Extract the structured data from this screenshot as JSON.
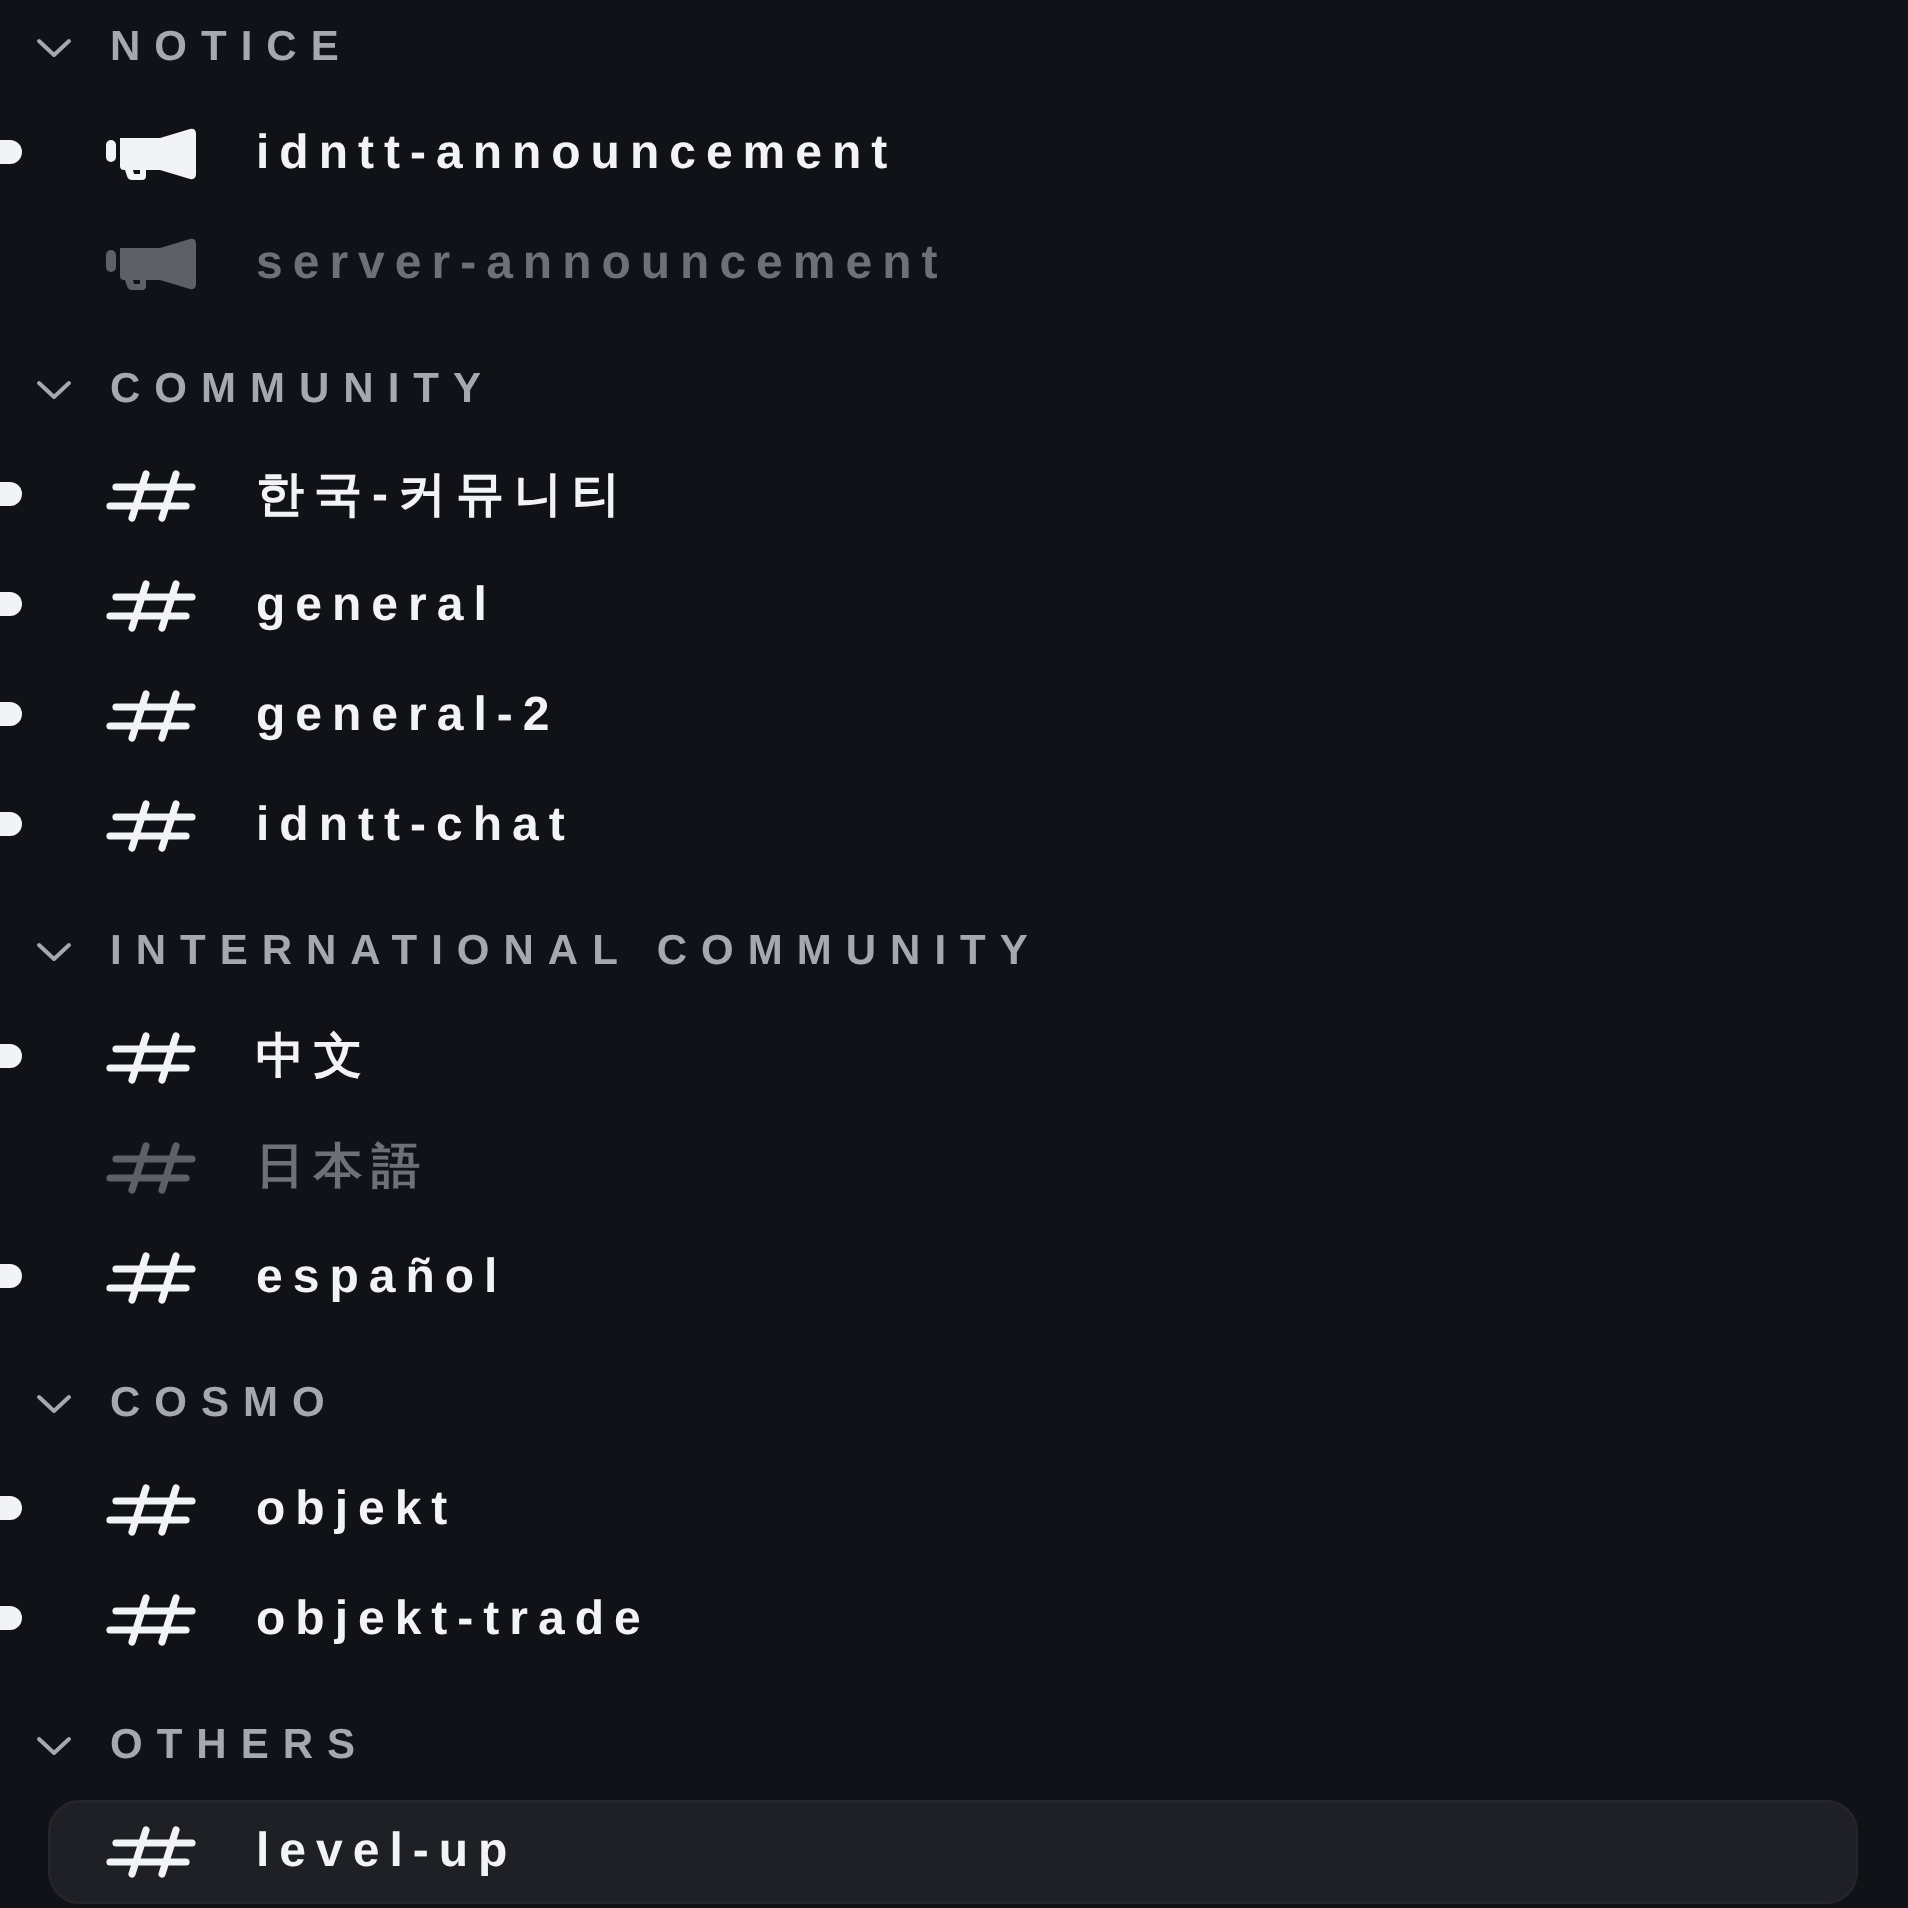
{
  "categories": [
    {
      "name": "NOTICE",
      "expanded": true,
      "channels": [
        {
          "kind": "announcement",
          "name": "idntt-announcement",
          "unread": true,
          "selected": false
        },
        {
          "kind": "announcement",
          "name": "server-announcement",
          "unread": false,
          "selected": false
        }
      ]
    },
    {
      "name": "COMMUNITY",
      "expanded": true,
      "channels": [
        {
          "kind": "text",
          "name": "한국-커뮤니티",
          "unread": true,
          "selected": false
        },
        {
          "kind": "text",
          "name": "general",
          "unread": true,
          "selected": false
        },
        {
          "kind": "text",
          "name": "general-2",
          "unread": true,
          "selected": false
        },
        {
          "kind": "text",
          "name": "idntt-chat",
          "unread": true,
          "selected": false
        }
      ]
    },
    {
      "name": "INTERNATIONAL COMMUNITY",
      "expanded": true,
      "channels": [
        {
          "kind": "text",
          "name": "中文",
          "unread": true,
          "selected": false
        },
        {
          "kind": "text",
          "name": "日本語",
          "unread": false,
          "selected": false
        },
        {
          "kind": "text",
          "name": "español",
          "unread": true,
          "selected": false
        }
      ]
    },
    {
      "name": "COSMO",
      "expanded": true,
      "channels": [
        {
          "kind": "text",
          "name": "objekt",
          "unread": true,
          "selected": false
        },
        {
          "kind": "text",
          "name": "objekt-trade",
          "unread": true,
          "selected": false
        }
      ]
    },
    {
      "name": "OTHERS",
      "expanded": true,
      "channels": [
        {
          "kind": "text",
          "name": "level-up",
          "unread": false,
          "selected": true
        }
      ]
    }
  ]
}
